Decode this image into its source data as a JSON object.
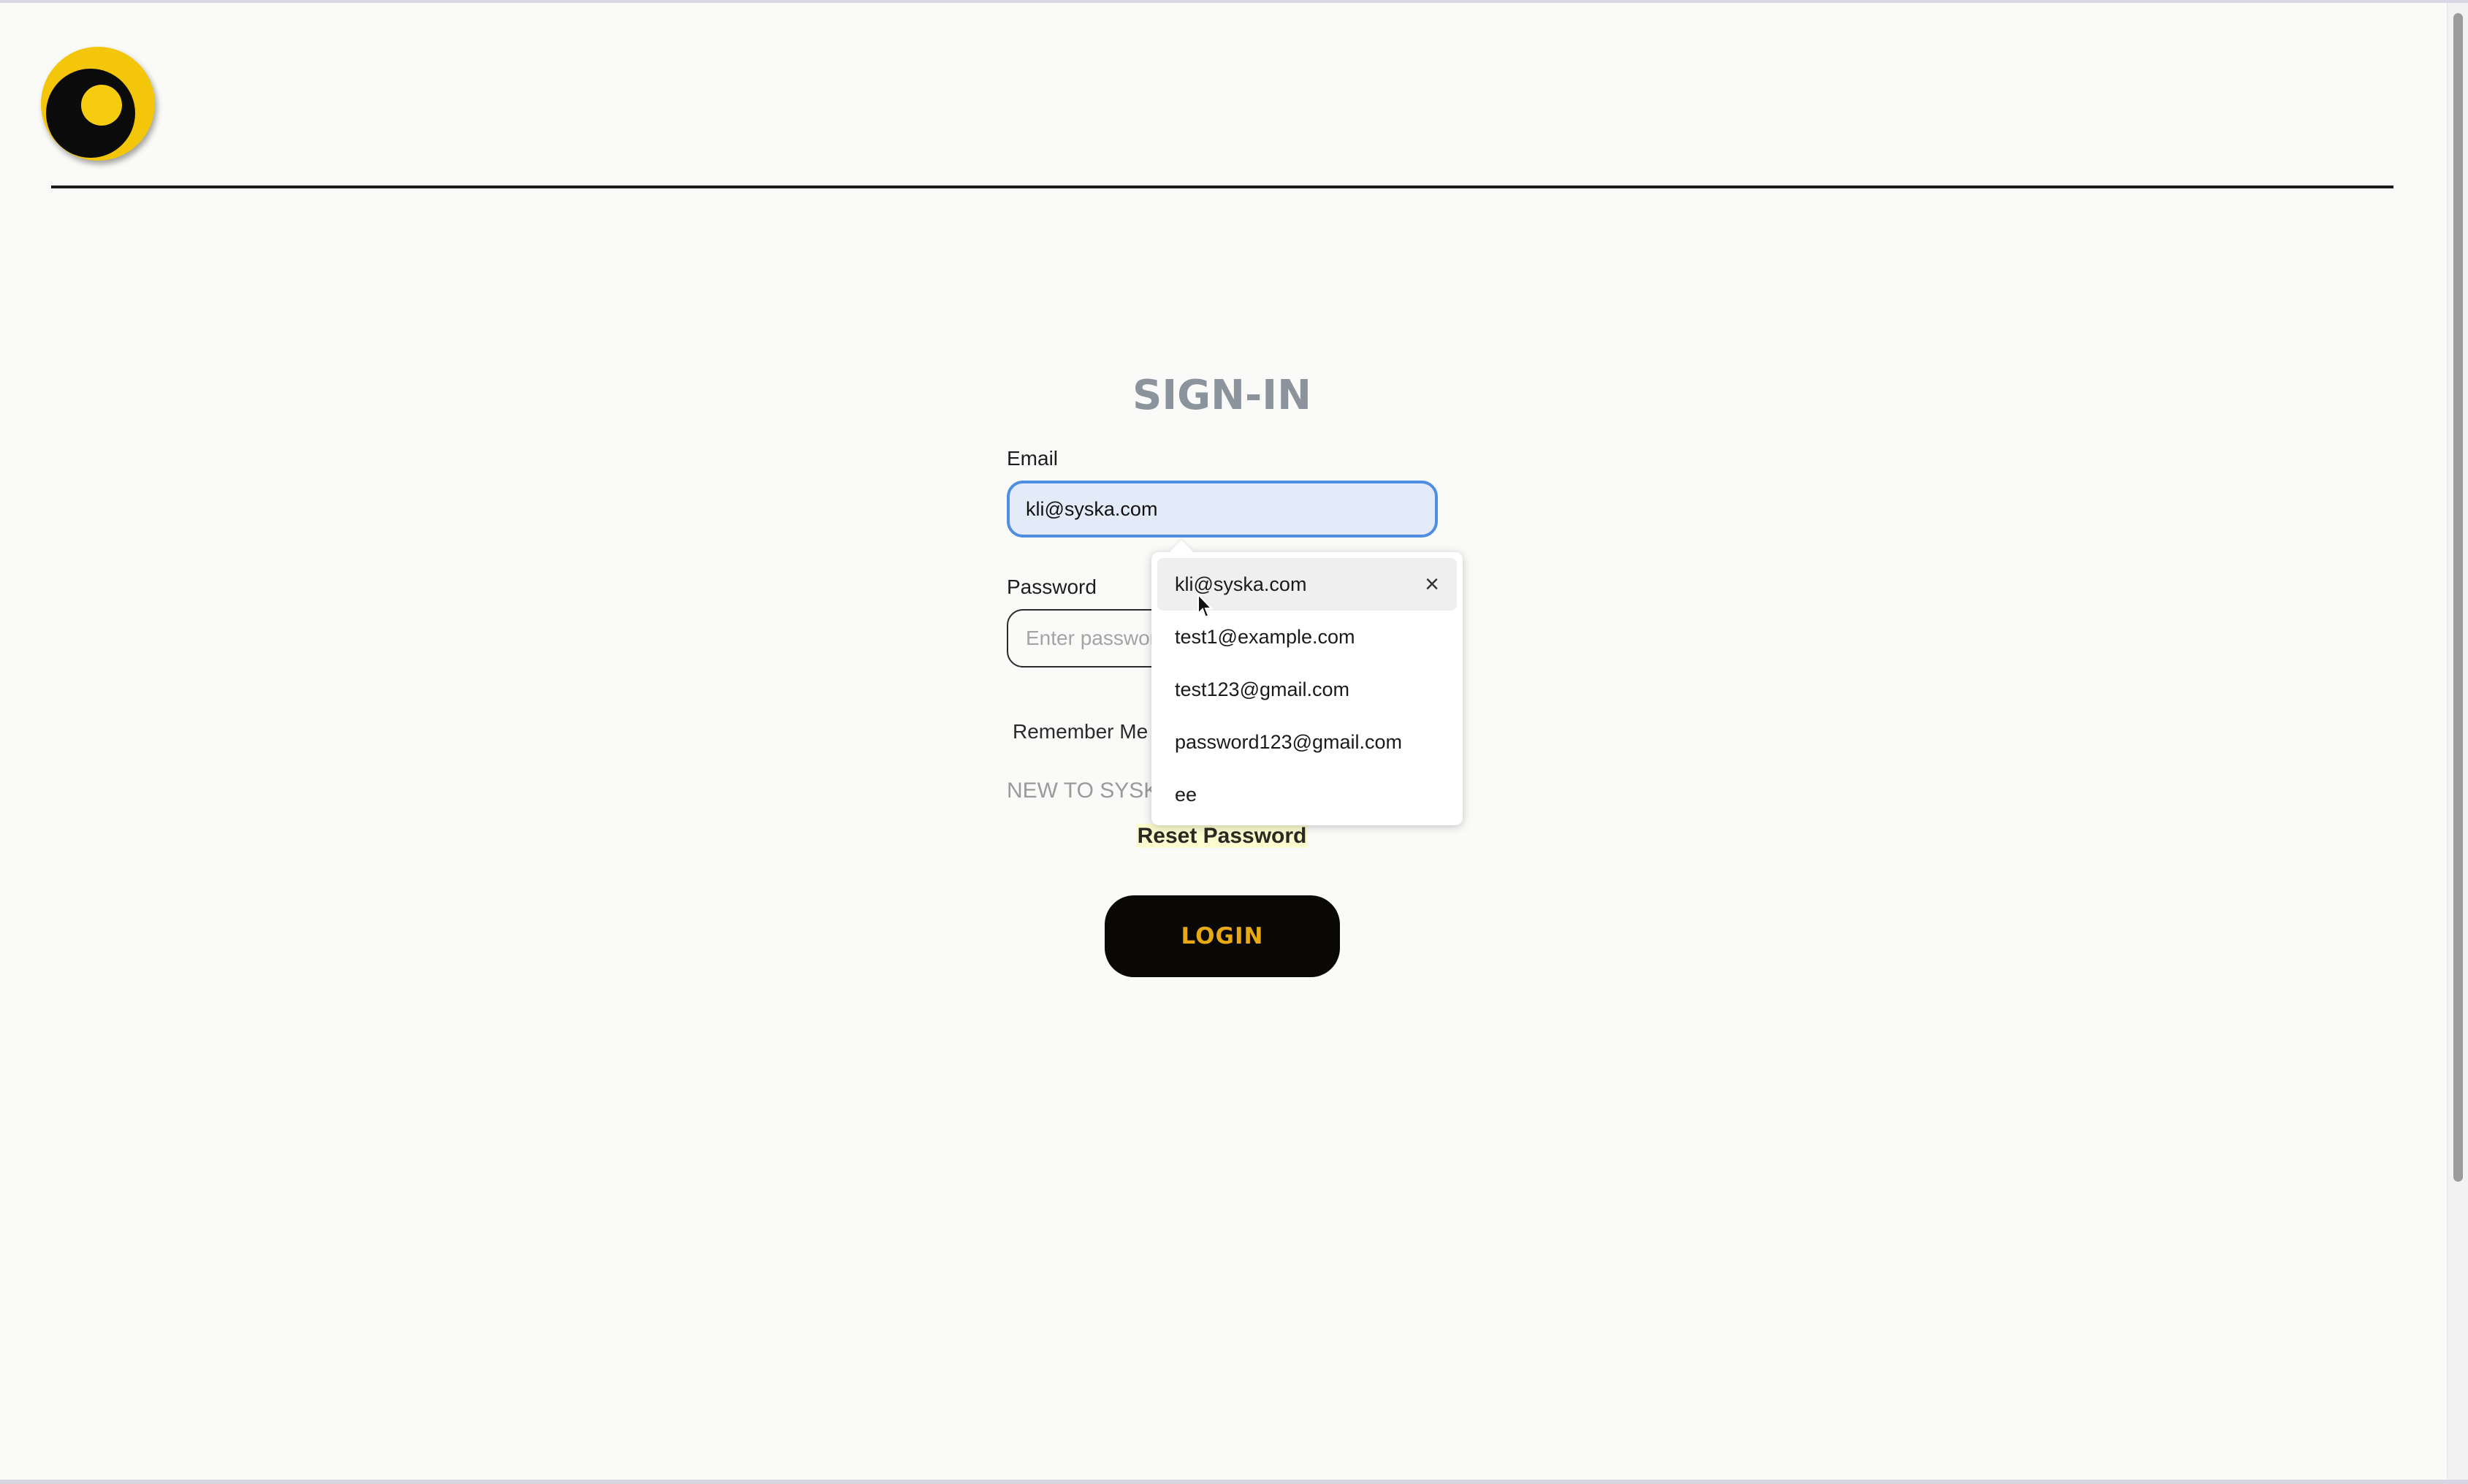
{
  "header": {
    "logo_icon": "logo-icon"
  },
  "form": {
    "title": "SIGN-IN",
    "email_label": "Email",
    "email_value": "kli@syska.com",
    "password_label": "Password",
    "password_placeholder": "Enter password",
    "remember_me": "Remember Me",
    "new_to_text": "NEW TO SYSKA?",
    "reset_password": "Reset Password",
    "login_label": "LOGIN"
  },
  "autocomplete": {
    "items": [
      {
        "text": "kli@syska.com",
        "removable": true
      },
      {
        "text": "test1@example.com"
      },
      {
        "text": "test123@gmail.com"
      },
      {
        "text": "password123@gmail.com"
      },
      {
        "text": "ee"
      }
    ],
    "close_icon": "close-icon"
  },
  "colors": {
    "accent": "#f3c60a",
    "login_text": "#e8a913",
    "title": "#8b939c",
    "focus_border": "#4f8ee0"
  }
}
